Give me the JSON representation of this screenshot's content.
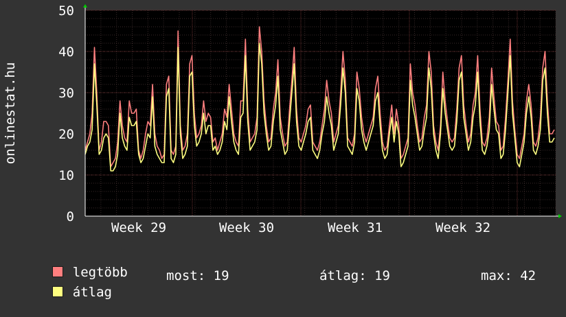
{
  "chart_data": {
    "type": "line",
    "ylabel": "onlinestat.hu",
    "xlabel": "",
    "ylim": [
      0,
      50
    ],
    "y_ticks": [
      "0",
      "10",
      "20",
      "30",
      "40",
      "50"
    ],
    "x_tick_labels": [
      "Week 29",
      "Week 30",
      "Week 31",
      "Week 32"
    ],
    "grid": true,
    "legend_placement": "bottom-left",
    "series": [
      {
        "name": "legtöbb",
        "color": "#ff7f7f",
        "values": [
          16,
          18,
          20,
          25,
          41,
          30,
          16,
          18,
          23,
          23,
          22,
          12,
          13,
          14,
          18,
          28,
          22,
          19,
          18,
          28,
          25,
          25,
          26,
          16,
          14,
          16,
          20,
          23,
          22,
          32,
          20,
          17,
          16,
          14,
          15,
          32,
          34,
          16,
          15,
          17,
          45,
          22,
          16,
          17,
          20,
          37,
          39,
          25,
          19,
          20,
          22,
          28,
          23,
          25,
          24,
          18,
          19,
          16,
          18,
          20,
          26,
          24,
          32,
          26,
          20,
          18,
          17,
          28,
          28,
          43,
          26,
          18,
          19,
          20,
          24,
          46,
          40,
          28,
          22,
          18,
          19,
          26,
          30,
          38,
          24,
          20,
          17,
          18,
          26,
          33,
          41,
          26,
          19,
          18,
          20,
          22,
          26,
          27,
          18,
          17,
          16,
          18,
          22,
          26,
          33,
          28,
          25,
          18,
          20,
          22,
          30,
          40,
          33,
          19,
          18,
          17,
          20,
          35,
          31,
          24,
          20,
          18,
          20,
          22,
          24,
          31,
          34,
          25,
          18,
          16,
          17,
          22,
          27,
          20,
          26,
          22,
          14,
          15,
          17,
          19,
          37,
          30,
          27,
          22,
          18,
          19,
          24,
          27,
          40,
          35,
          22,
          18,
          16,
          22,
          35,
          28,
          23,
          19,
          18,
          19,
          26,
          36,
          39,
          27,
          22,
          18,
          20,
          27,
          30,
          39,
          26,
          18,
          17,
          19,
          24,
          36,
          29,
          23,
          22,
          16,
          17,
          24,
          33,
          43,
          28,
          21,
          15,
          14,
          17,
          20,
          28,
          32,
          27,
          18,
          17,
          19,
          24,
          36,
          40,
          28,
          20,
          20,
          21
        ],
        "__note": ""
      },
      {
        "name": "átlag",
        "color": "#ffff80",
        "values": [
          15,
          17,
          18,
          21,
          37,
          27,
          15,
          16,
          19,
          20,
          19,
          11,
          11,
          12,
          15,
          25,
          19,
          17,
          16,
          24,
          22,
          22,
          23,
          15,
          13,
          14,
          17,
          20,
          19,
          29,
          17,
          15,
          14,
          13,
          13,
          29,
          31,
          14,
          13,
          15,
          41,
          20,
          14,
          15,
          17,
          34,
          35,
          22,
          17,
          18,
          20,
          25,
          20,
          22,
          22,
          16,
          17,
          15,
          16,
          18,
          23,
          21,
          29,
          23,
          18,
          16,
          15,
          24,
          25,
          39,
          23,
          16,
          17,
          18,
          21,
          42,
          37,
          25,
          20,
          16,
          17,
          23,
          27,
          34,
          21,
          18,
          15,
          16,
          23,
          30,
          37,
          23,
          17,
          16,
          18,
          20,
          23,
          24,
          16,
          15,
          14,
          16,
          20,
          23,
          29,
          25,
          22,
          16,
          18,
          20,
          27,
          36,
          30,
          17,
          16,
          15,
          18,
          31,
          28,
          21,
          18,
          16,
          18,
          20,
          22,
          28,
          30,
          22,
          16,
          14,
          15,
          20,
          24,
          18,
          23,
          20,
          12,
          13,
          15,
          17,
          33,
          27,
          24,
          20,
          16,
          17,
          21,
          24,
          36,
          31,
          20,
          16,
          14,
          20,
          31,
          25,
          21,
          17,
          16,
          17,
          23,
          33,
          35,
          24,
          20,
          16,
          18,
          24,
          27,
          35,
          23,
          16,
          15,
          17,
          21,
          32,
          26,
          21,
          20,
          14,
          15,
          21,
          30,
          39,
          25,
          19,
          13,
          12,
          15,
          18,
          25,
          29,
          24,
          16,
          15,
          17,
          21,
          33,
          36,
          25,
          18,
          18,
          19
        ]
      }
    ]
  },
  "legend": [
    {
      "label": "legtöbb",
      "color": "#ff7f7f"
    },
    {
      "label": "átlag",
      "color": "#ffff80"
    }
  ],
  "stats": {
    "most": "most: 19",
    "atlag": "átlag: 19",
    "max": "max: 42"
  }
}
